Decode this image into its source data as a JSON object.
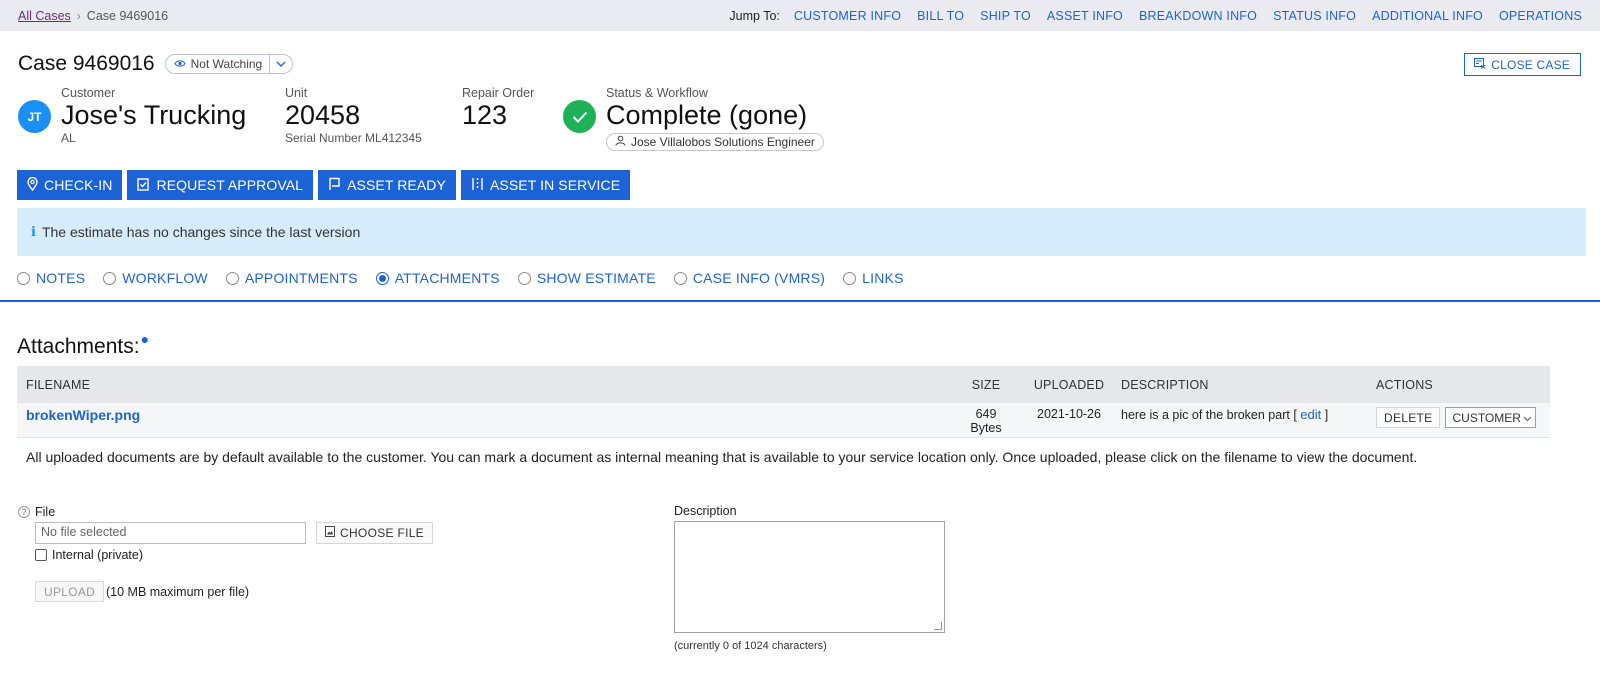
{
  "breadcrumb": {
    "all_cases": "All Cases",
    "current": "Case 9469016"
  },
  "jump": {
    "label": "Jump To:",
    "links": [
      "CUSTOMER INFO",
      "BILL TO",
      "SHIP TO",
      "ASSET INFO",
      "BREAKDOWN INFO",
      "STATUS INFO",
      "ADDITIONAL INFO",
      "OPERATIONS"
    ]
  },
  "header": {
    "case_title": "Case 9469016",
    "watch_label": "Not Watching",
    "close_case_label": "CLOSE CASE"
  },
  "customer": {
    "label": "Customer",
    "initials": "JT",
    "name": "Jose's Trucking",
    "state": "AL"
  },
  "unit": {
    "label": "Unit",
    "number": "20458",
    "serial": "Serial Number ML412345"
  },
  "repair_order": {
    "label": "Repair Order",
    "number": "123"
  },
  "status": {
    "label": "Status & Workflow",
    "value": "Complete (gone)",
    "assignee": "Jose Villalobos Solutions Engineer",
    "color": "#1db257"
  },
  "actions": [
    "CHECK-IN",
    "REQUEST APPROVAL",
    "ASSET READY",
    "ASSET IN SERVICE"
  ],
  "notice": "The estimate has no changes since the last version",
  "tabs": [
    {
      "label": "NOTES",
      "selected": false
    },
    {
      "label": "WORKFLOW",
      "selected": false
    },
    {
      "label": "APPOINTMENTS",
      "selected": false
    },
    {
      "label": "ATTACHMENTS",
      "selected": true
    },
    {
      "label": "SHOW ESTIMATE",
      "selected": false
    },
    {
      "label": "CASE INFO (VMRS)",
      "selected": false
    },
    {
      "label": "LINKS",
      "selected": false
    }
  ],
  "attachments": {
    "title": "Attachments:",
    "columns": [
      "FILENAME",
      "SIZE",
      "UPLOADED",
      "DESCRIPTION",
      "ACTIONS"
    ],
    "rows": [
      {
        "filename": "brokenWiper.png",
        "size_value": "649",
        "size_unit": "Bytes",
        "uploaded": "2021-10-26",
        "description": "here is a pic of the broken part",
        "edit_label": "edit",
        "delete_label": "DELETE",
        "visibility": "CUSTOMER"
      }
    ],
    "help_text": "All uploaded documents are by default available to the customer. You can mark a document as internal meaning that is available to your service location only. Once uploaded, please click on the filename to view the document."
  },
  "upload_form": {
    "file_label": "File",
    "help_icon": "?",
    "file_placeholder": "No file selected",
    "choose_label": "CHOOSE FILE",
    "internal_label": "Internal (private)",
    "upload_label": "UPLOAD",
    "upload_note": "(10 MB maximum per file)",
    "description_label": "Description",
    "char_count": "(currently 0 of 1024 characters)"
  },
  "colors": {
    "accent": "#1d63d8",
    "notice_bg": "#d5ecfa",
    "avatar": "#1a8ff5"
  }
}
